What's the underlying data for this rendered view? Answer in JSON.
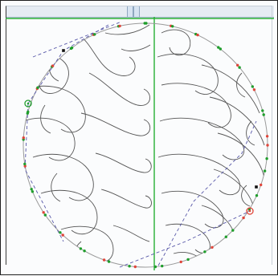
{
  "canvas": {
    "colors": {
      "quilt_line": "#555555",
      "boundary": "#9a9a9a",
      "guide": "#27b035",
      "path": "#5757a8",
      "node_green": "#1f9e2c",
      "node_red": "#e0453a",
      "node_black": "#111111",
      "ruler": "#e6ecf3"
    },
    "icons": {
      "start_marker": "circle-target-icon",
      "end_marker": "circle-target-icon"
    }
  }
}
